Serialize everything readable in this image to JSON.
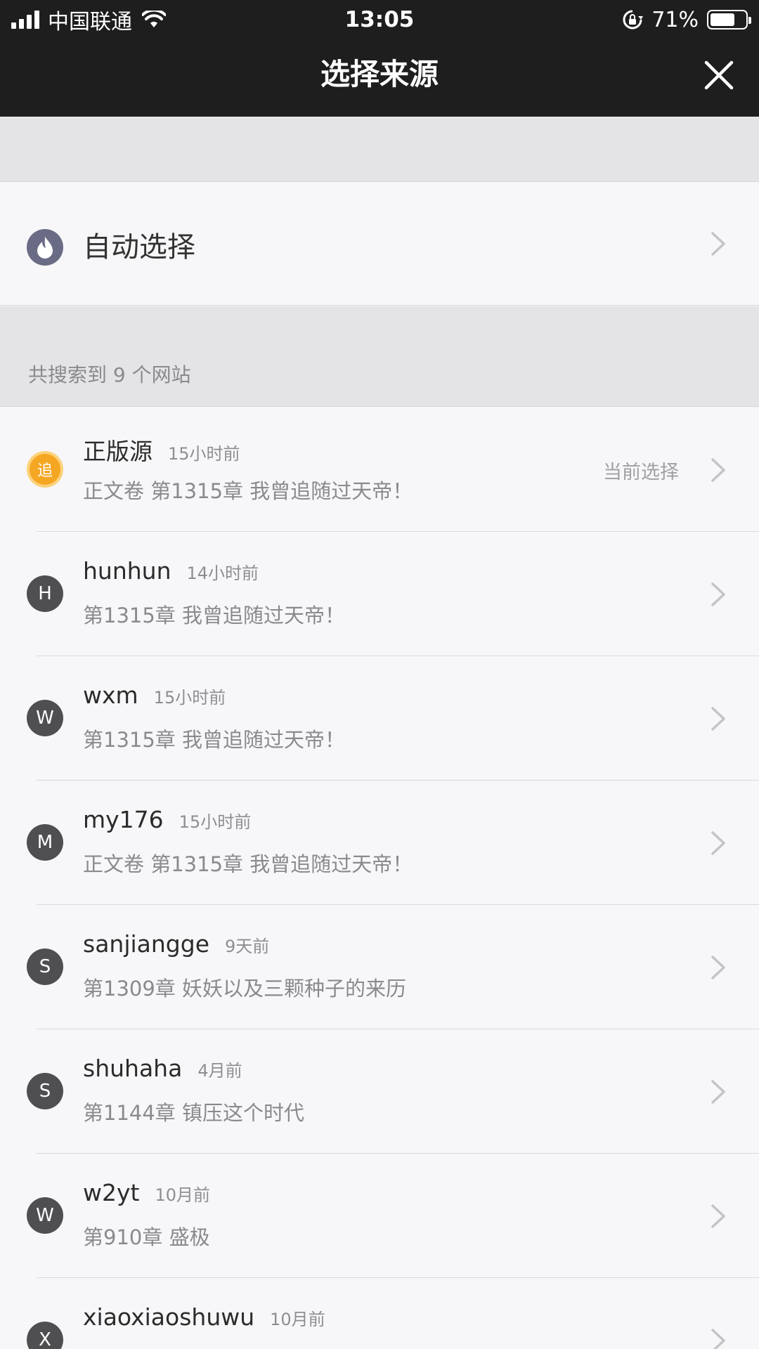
{
  "status_bar": {
    "carrier": "中国联通",
    "time": "13:05",
    "battery": "71%",
    "battery_level": 0.71
  },
  "nav": {
    "title": "选择来源"
  },
  "auto_select": {
    "label": "自动选择"
  },
  "section": {
    "label": "共搜索到 9 个网站"
  },
  "sources": [
    {
      "avatar": "追",
      "name": "正版源",
      "time": "15小时前",
      "chapter": "正文卷 第1315章 我曾追随过天帝！",
      "current": "当前选择"
    },
    {
      "avatar": "H",
      "name": "hunhun",
      "time": "14小时前",
      "chapter": "第1315章 我曾追随过天帝！"
    },
    {
      "avatar": "W",
      "name": "wxm",
      "time": "15小时前",
      "chapter": "第1315章 我曾追随过天帝！"
    },
    {
      "avatar": "M",
      "name": "my176",
      "time": "15小时前",
      "chapter": "正文卷 第1315章 我曾追随过天帝！"
    },
    {
      "avatar": "S",
      "name": "sanjiangge",
      "time": "9天前",
      "chapter": "第1309章 妖妖以及三颗种子的来历"
    },
    {
      "avatar": "S",
      "name": "shuhaha",
      "time": "4月前",
      "chapter": "第1144章 镇压这个时代"
    },
    {
      "avatar": "W",
      "name": "w2yt",
      "time": "10月前",
      "chapter": "第910章 盛极"
    },
    {
      "avatar": "X",
      "name": "xiaoxiaoshuwu",
      "time": "10月前",
      "chapter": ""
    }
  ],
  "colors": {
    "topbar": "#1e1e1e",
    "official_badge": "#f5a623",
    "avatar": "#4f4f52",
    "auto_icon": "#6a6b85"
  }
}
